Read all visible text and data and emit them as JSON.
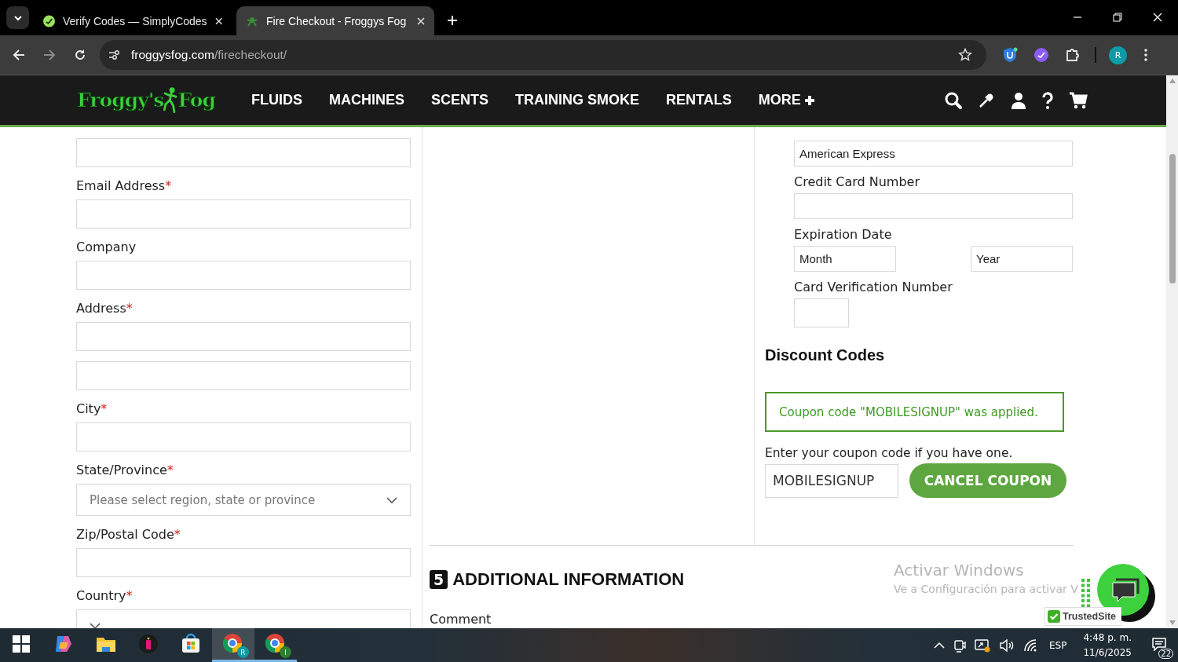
{
  "browser": {
    "tabs": [
      {
        "title": "Verify Codes — SimplyCodes",
        "kind": "simplycodes",
        "selected": false
      },
      {
        "title": "Fire Checkout - Froggys Fog",
        "kind": "frog",
        "selected": true
      }
    ],
    "url_domain": "froggysfog.com",
    "url_path": "/firecheckout/",
    "profile_initial": "R"
  },
  "site_header": {
    "logo_words": [
      "Froggy's",
      "Fog"
    ],
    "nav": [
      {
        "label": "FLUIDS",
        "plus": false
      },
      {
        "label": "MACHINES",
        "plus": false
      },
      {
        "label": "SCENTS",
        "plus": false
      },
      {
        "label": "TRAINING SMOKE",
        "plus": false
      },
      {
        "label": "RENTALS",
        "plus": false
      },
      {
        "label": "MORE",
        "plus": true
      }
    ]
  },
  "billing_form": {
    "fields": [
      {
        "kind": "text"
      },
      {
        "label": "Email Address",
        "required_mark": "*",
        "kind": "text"
      },
      {
        "label": "Company",
        "kind": "text"
      },
      {
        "label": "Address",
        "required_mark": "*",
        "kind": "text"
      },
      {
        "kind": "text"
      },
      {
        "label": "City",
        "required_mark": "*",
        "kind": "text"
      },
      {
        "label": "State/Province",
        "required_mark": "*",
        "kind": "select",
        "placeholder": "Please select region, state or province"
      },
      {
        "label": "Zip/Postal Code",
        "required_mark": "*",
        "kind": "text"
      },
      {
        "label": "Country",
        "required_mark": "*",
        "kind": "select"
      }
    ]
  },
  "payment": {
    "fields": [
      {
        "kind": "text",
        "value": "American Express"
      },
      {
        "label": "Credit Card Number",
        "kind": "text"
      },
      {
        "label": "Expiration Date",
        "kind": "pair",
        "options": [
          "Month",
          "Year"
        ]
      },
      {
        "label": "Card Verification Number",
        "kind": "short"
      }
    ]
  },
  "discount": {
    "title": "Discount Codes",
    "message": "Coupon code \"MOBILESIGNUP\" was applied.",
    "prompt": "Enter your coupon code if you have one.",
    "code": "MOBILESIGNUP",
    "button": "CANCEL COUPON"
  },
  "additional": {
    "number": "5",
    "title": "ADDITIONAL INFORMATION",
    "comment_label": "Comment"
  },
  "os_watermark": {
    "title": "Activar Windows",
    "text": "Ve a Configuración para activar V"
  },
  "trust_badge": "TrustedSite",
  "taskbar": {
    "apps": [
      {
        "kind": "start",
        "selected": false,
        "running": false
      },
      {
        "kind": "copilot",
        "selected": false,
        "running": false
      },
      {
        "kind": "explorer",
        "selected": false,
        "running": false
      },
      {
        "kind": "app",
        "selected": false,
        "running": false
      },
      {
        "kind": "store",
        "selected": false,
        "running": false
      },
      {
        "kind": "chrome",
        "badge": "R",
        "color": "#0e9aa7",
        "selected": true,
        "running": true
      },
      {
        "kind": "chrome",
        "badge": "I",
        "color": "#2e7d32",
        "selected": false,
        "running": true
      }
    ],
    "tray": {
      "language": "ESP",
      "time": "4:48 p. m.",
      "date": "11/6/2025",
      "notifications": "22"
    }
  }
}
